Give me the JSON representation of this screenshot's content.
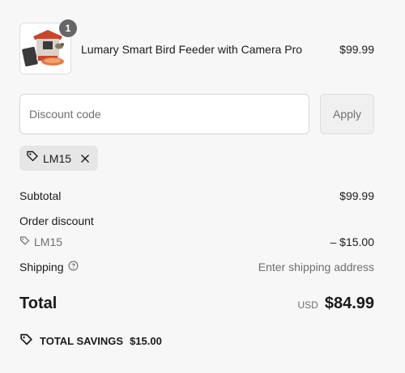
{
  "product": {
    "quantity": "1",
    "name": "Lumary Smart Bird Feeder with Camera Pro",
    "price": "$99.99"
  },
  "discount": {
    "placeholder": "Discount code",
    "apply_label": "Apply",
    "applied_code": "LM15"
  },
  "summary": {
    "subtotal_label": "Subtotal",
    "subtotal_value": "$99.99",
    "order_discount_label": "Order discount",
    "discount_code": "LM15",
    "discount_value": "– $15.00",
    "shipping_label": "Shipping",
    "shipping_value": "Enter shipping address",
    "total_label": "Total",
    "currency": "USD",
    "total_value": "$84.99",
    "savings_label": "TOTAL SAVINGS",
    "savings_value": "$15.00"
  },
  "icons": {
    "tag": "tag-icon",
    "remove": "close-icon",
    "help": "question-circle-icon"
  }
}
